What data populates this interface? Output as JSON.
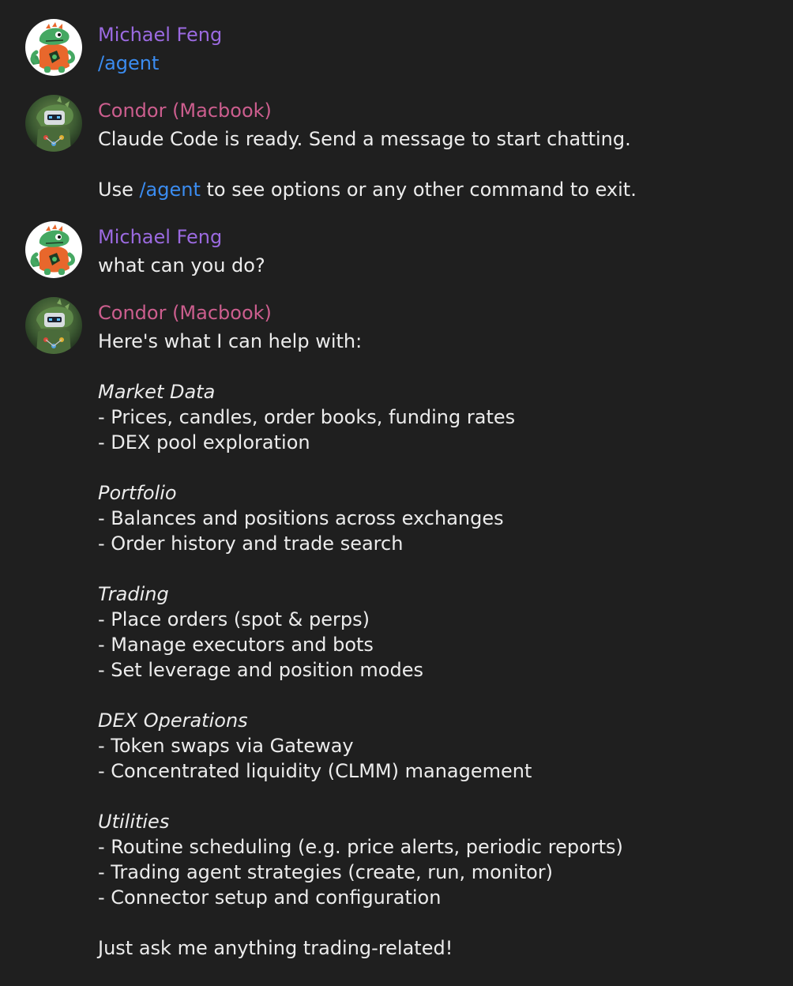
{
  "colors": {
    "background": "#1f1f1f",
    "text": "#ececec",
    "user_name": "#9b6ae0",
    "bot_name": "#cc5e8e",
    "link": "#3b8cf0"
  },
  "messages": [
    {
      "sender": "Michael Feng",
      "avatar_icon": "gecko-orange-shirt-icon",
      "command": "/agent"
    },
    {
      "sender": "Condor (Macbook)",
      "avatar_icon": "robot-dino-icon",
      "line1": "Claude Code is ready. Send a message to start chatting.",
      "line2_pre": "Use ",
      "line2_link": "/agent",
      "line2_post": " to see options or any other command to exit."
    },
    {
      "sender": "Michael Feng",
      "avatar_icon": "gecko-orange-shirt-icon",
      "text": "what can you do?"
    },
    {
      "sender": "Condor (Macbook)",
      "avatar_icon": "robot-dino-icon",
      "intro": "Here's what I can help with:",
      "sections": [
        {
          "heading": "Market Data",
          "items": [
            "- Prices, candles, order books, funding rates",
            "- DEX pool exploration"
          ]
        },
        {
          "heading": "Portfolio",
          "items": [
            "- Balances and positions across exchanges",
            "- Order history and trade search"
          ]
        },
        {
          "heading": "Trading",
          "items": [
            "- Place orders (spot & perps)",
            "- Manage executors and bots",
            "- Set leverage and position modes"
          ]
        },
        {
          "heading": "DEX Operations",
          "items": [
            "- Token swaps via Gateway",
            "- Concentrated liquidity (CLMM) management"
          ]
        },
        {
          "heading": "Utilities",
          "items": [
            "- Routine scheduling (e.g. price alerts, periodic reports)",
            "- Trading agent strategies (create, run, monitor)",
            "- Connector setup and configuration"
          ]
        }
      ],
      "outro": "Just ask me anything trading-related!"
    }
  ]
}
